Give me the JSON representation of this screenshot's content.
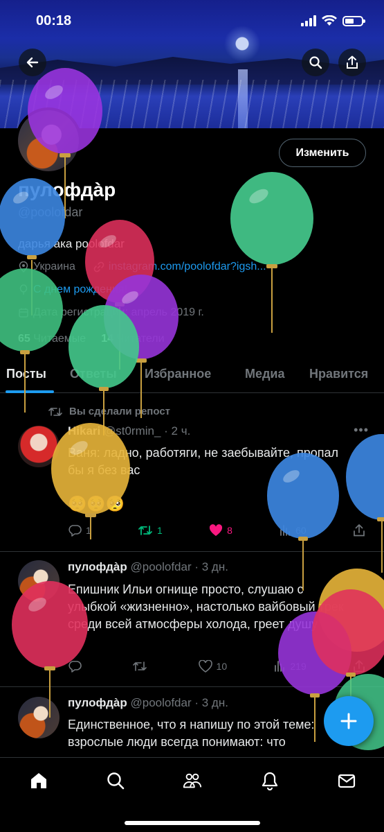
{
  "status": {
    "time": "00:18"
  },
  "profile": {
    "display_name": "пулофдàр",
    "handle": "@poolofdar",
    "bio": "дарья ака poolofdar",
    "location": "Украина",
    "website": "instagram.com/poolofdar?igsh...",
    "birthday": "С днем рождения!",
    "joined": "Дата регистрации: апрель 2019 г.",
    "following_count": "65",
    "following_label": "Читаемые",
    "followers_count": "14",
    "followers_label": "Читатели",
    "edit_label": "Изменить"
  },
  "tabs": [
    "Посты",
    "Ответы",
    "Избранное",
    "Медиа",
    "Нравится"
  ],
  "feed": {
    "repost_label": "Вы сделали репост",
    "tweets": [
      {
        "name": "Hikari",
        "handle": "@st0rmin_",
        "time": "· 2 ч.",
        "text": "Ваня: ладно, работяги, не заебывайте, пропал бы я без вас",
        "emoji": "🥺🥺🥺",
        "replies": "1",
        "reposts": "1",
        "likes": "8",
        "views": "60"
      },
      {
        "name": "пулофдàр",
        "handle": "@poolofdar",
        "time": "· 3 дн.",
        "text": "Епишник Ильи огнище просто, слушаю с улыбкой «жизненно», настолько вайбовый трек среди всей атмосферы холода, греет душу",
        "replies": "",
        "reposts": "",
        "likes": "10",
        "views": "219"
      },
      {
        "name": "пулофдàр",
        "handle": "@poolofdar",
        "time": "· 3 дн.",
        "text": "Единственное, что я напишу по этой теме: взрослые люди всегда понимают: что"
      }
    ]
  },
  "colors": {
    "accent": "#1d9bf0",
    "like": "#f91880",
    "repost": "#00ba7c",
    "muted": "#71767b"
  }
}
